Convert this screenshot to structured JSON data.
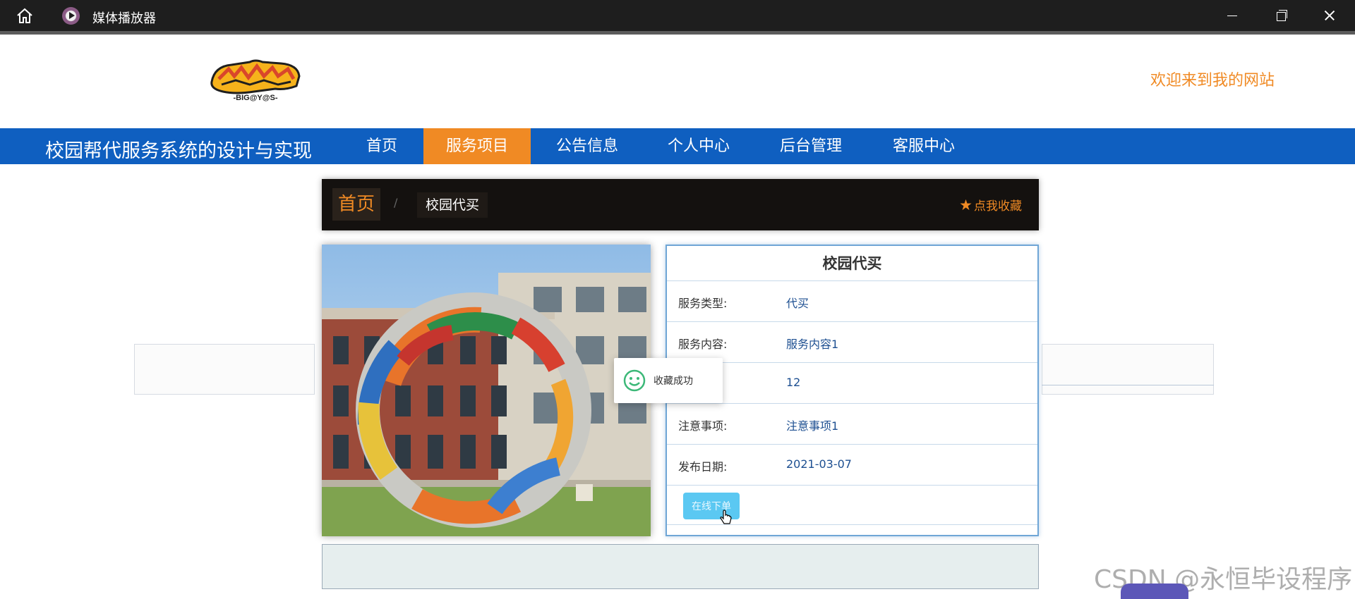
{
  "window": {
    "title": "媒体播放器",
    "icons": {
      "home": "home-icon",
      "app": "media-player-icon",
      "minimize": "minimize-icon",
      "maximize": "restore-icon",
      "close": "close-icon"
    }
  },
  "header": {
    "logo_text": "-BIG@Y@S-",
    "welcome": "欢迎来到我的网站"
  },
  "nav": {
    "site_title": "校园帮代服务系统的设计与实现",
    "items": [
      {
        "label": "首页",
        "active": false
      },
      {
        "label": "服务项目",
        "active": true
      },
      {
        "label": "公告信息",
        "active": false
      },
      {
        "label": "个人中心",
        "active": false
      },
      {
        "label": "后台管理",
        "active": false
      },
      {
        "label": "客服中心",
        "active": false
      }
    ]
  },
  "breadcrumb": {
    "home": "首页",
    "separator": "/",
    "current": "校园代买",
    "favorite_label": "点我收藏"
  },
  "detail": {
    "title": "校园代买",
    "rows": [
      {
        "label": "服务类型:",
        "value": "代买"
      },
      {
        "label": "服务内容:",
        "value": "服务内容1"
      },
      {
        "label": "",
        "value": "12"
      },
      {
        "label": "注意事项:",
        "value": "注意事项1"
      },
      {
        "label": "发布日期:",
        "value": "2021-03-07"
      }
    ],
    "order_button": "在线下单"
  },
  "toast": {
    "message": "收藏成功",
    "icon": "smile-icon"
  },
  "watermark": "CSDN @永恒毕设程序",
  "colors": {
    "nav_bg": "#0f5fc0",
    "accent_orange": "#f08a24",
    "button_blue": "#5bc8f2",
    "breadcrumb_bg": "#14110f"
  }
}
